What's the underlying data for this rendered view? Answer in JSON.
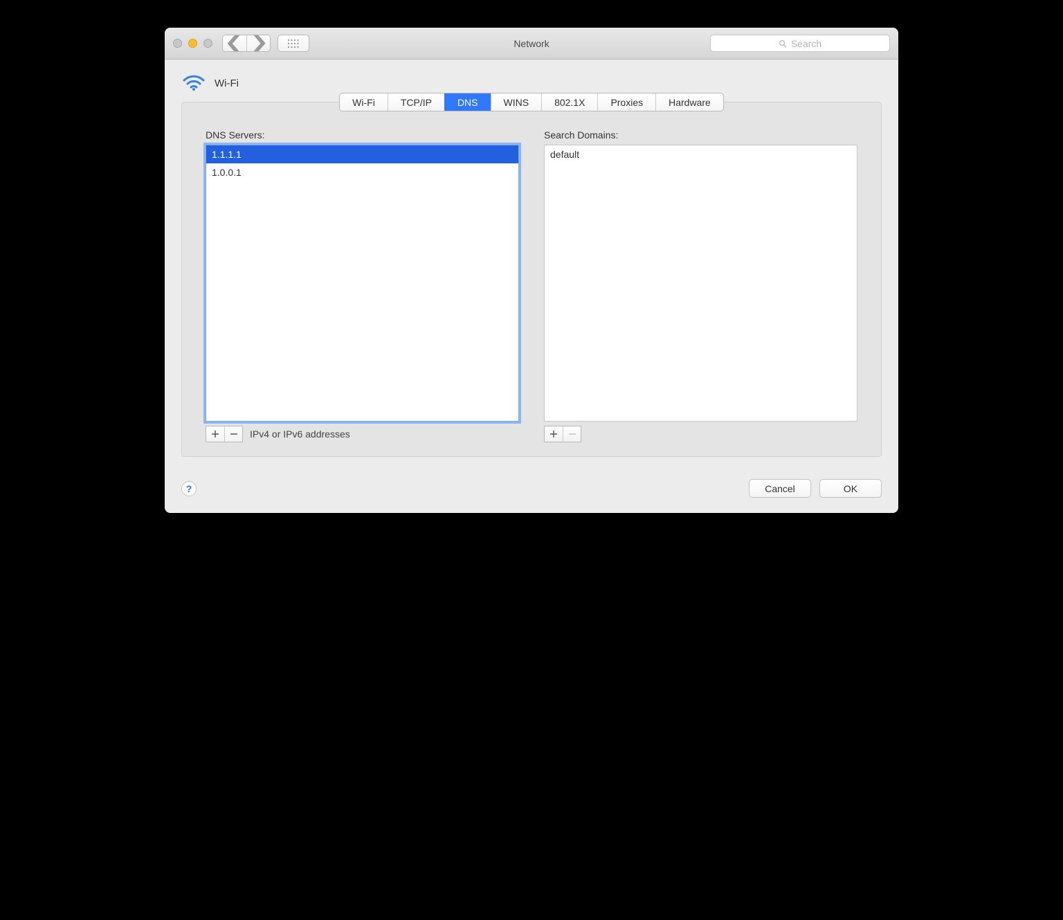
{
  "window_title": "Network",
  "search_placeholder": "Search",
  "header": {
    "interface_label": "Wi-Fi"
  },
  "tabs": {
    "t0": "Wi-Fi",
    "t1": "TCP/IP",
    "t2": "DNS",
    "t3": "WINS",
    "t4": "802.1X",
    "t5": "Proxies",
    "t6": "Hardware"
  },
  "dns": {
    "label": "DNS Servers:",
    "items": {
      "i0": "1.1.1.1",
      "i1": "1.0.0.1"
    },
    "helper": "IPv4 or IPv6 addresses"
  },
  "search_domains": {
    "label": "Search Domains:",
    "items": {
      "i0": "default"
    }
  },
  "buttons": {
    "cancel": "Cancel",
    "ok": "OK",
    "help": "?"
  }
}
